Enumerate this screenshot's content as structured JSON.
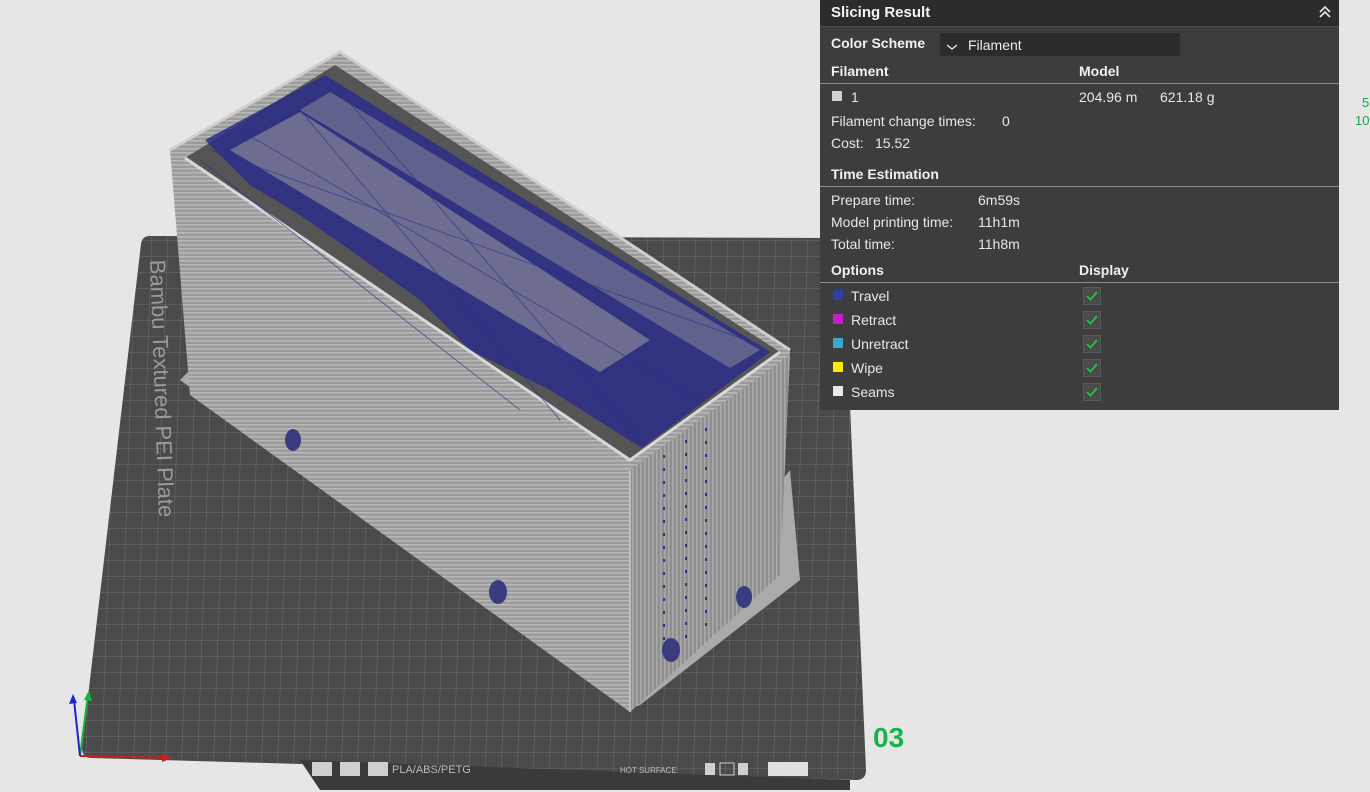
{
  "panel": {
    "title": "Slicing Result",
    "color_scheme_label": "Color Scheme",
    "color_scheme_value": "Filament",
    "filament_header": "Filament",
    "model_header": "Model",
    "filament_row": {
      "index": "1",
      "length": "204.96 m",
      "weight": "621.18 g",
      "color": "#d0d0d0"
    },
    "change_times_label": "Filament change times:",
    "change_times_value": "0",
    "cost_label": "Cost:",
    "cost_value": "15.52",
    "time_header": "Time Estimation",
    "prepare_label": "Prepare time:",
    "prepare_value": "6m59s",
    "model_time_label": "Model printing time:",
    "model_time_value": "11h1m",
    "total_label": "Total time:",
    "total_value": "11h8m",
    "options_header": "Options",
    "display_header": "Display",
    "options": [
      {
        "label": "Travel",
        "color": "#2f3fa8",
        "checked": true
      },
      {
        "label": "Retract",
        "color": "#c81ec8",
        "checked": true
      },
      {
        "label": "Unretract",
        "color": "#3aa8c8",
        "checked": true
      },
      {
        "label": "Wipe",
        "color": "#ffea00",
        "checked": true
      },
      {
        "label": "Seams",
        "color": "#e8e8e8",
        "checked": true
      }
    ]
  },
  "plate": {
    "texture_label": "Bambu Textured PEI Plate",
    "filament_types": "PLA/ABS/PETG",
    "hot_surface": "HOT SURFACE",
    "plate_number": "03"
  },
  "side_numbers": [
    "5",
    "10"
  ]
}
